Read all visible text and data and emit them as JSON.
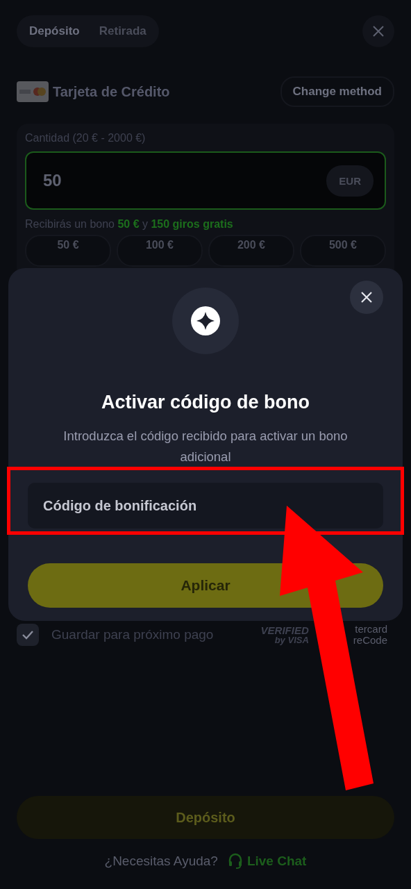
{
  "tabs": [
    {
      "label": "Depósito",
      "selected": true
    },
    {
      "label": "Retirada",
      "selected": false
    }
  ],
  "payment_method": {
    "label": "Tarjeta de Crédito",
    "change_button": "Change method"
  },
  "amount": {
    "label": "Cantidad (20 € - 2000 €)",
    "value": "50",
    "currency": "EUR",
    "bonus_note": "Recibirás un bono **50 €** y **150 giros gratis**"
  },
  "presets": [
    "50 €",
    "100 €",
    "200 €",
    "500 €"
  ],
  "bonus_dialog": {
    "title": "Activar código de bono",
    "description": "Introduzca el código recibido para activar un bono adicional",
    "input": {
      "placeholder": "Código de bonificación"
    },
    "apply_button": "Aplicar"
  },
  "save_payment": {
    "label": "Guardar para próximo pago",
    "checked": true
  },
  "verified_by_visa": [
    "VERIFIED",
    "by VISA"
  ],
  "securecode_logo": [
    "tercard",
    "reCode"
  ],
  "deposit_button": "Depósito",
  "help": {
    "question": "¿Necesitas Ayuda?",
    "link": "Live Chat"
  }
}
